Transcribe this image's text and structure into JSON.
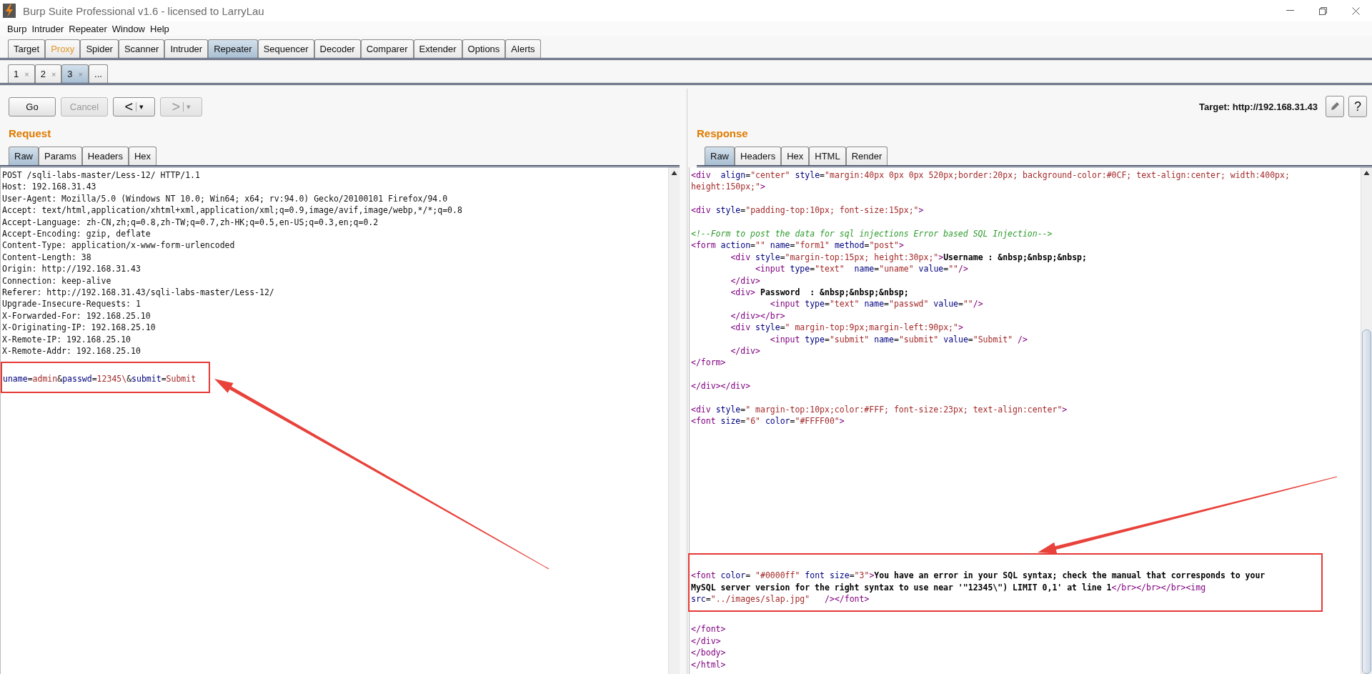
{
  "window": {
    "title": "Burp Suite Professional v1.6 - licensed to LarryLau"
  },
  "menu": [
    "Burp",
    "Intruder",
    "Repeater",
    "Window",
    "Help"
  ],
  "main_tabs": [
    {
      "label": "Target",
      "selected": false,
      "highlighted": false
    },
    {
      "label": "Proxy",
      "selected": false,
      "highlighted": true
    },
    {
      "label": "Spider",
      "selected": false,
      "highlighted": false
    },
    {
      "label": "Scanner",
      "selected": false,
      "highlighted": false
    },
    {
      "label": "Intruder",
      "selected": false,
      "highlighted": false
    },
    {
      "label": "Repeater",
      "selected": true,
      "highlighted": false
    },
    {
      "label": "Sequencer",
      "selected": false,
      "highlighted": false
    },
    {
      "label": "Decoder",
      "selected": false,
      "highlighted": false
    },
    {
      "label": "Comparer",
      "selected": false,
      "highlighted": false
    },
    {
      "label": "Extender",
      "selected": false,
      "highlighted": false
    },
    {
      "label": "Options",
      "selected": false,
      "highlighted": false
    },
    {
      "label": "Alerts",
      "selected": false,
      "highlighted": false
    }
  ],
  "sub_tabs": [
    {
      "label": "1",
      "close": "×",
      "selected": false
    },
    {
      "label": "2",
      "close": "×",
      "selected": false
    },
    {
      "label": "3",
      "close": "×",
      "selected": true
    }
  ],
  "more_tab": "...",
  "toolbar": {
    "buttons": [
      {
        "kind": "text",
        "label": "Go",
        "disabled": false
      },
      {
        "kind": "text",
        "label": "Cancel",
        "disabled": true
      },
      {
        "kind": "nav",
        "label": "<",
        "menu": "▾",
        "disabled": false
      },
      {
        "kind": "nav",
        "label": ">",
        "menu": "▾",
        "disabled": true
      }
    ],
    "target": "Target: http://192.168.31.43",
    "help": "?"
  },
  "request": {
    "title": "Request",
    "tabs": [
      {
        "label": "Raw",
        "selected": true
      },
      {
        "label": "Params",
        "selected": false
      },
      {
        "label": "Headers",
        "selected": false
      },
      {
        "label": "Hex",
        "selected": false
      }
    ],
    "headers": [
      "POST /sqli-labs-master/Less-12/ HTTP/1.1",
      "Host: 192.168.31.43",
      "User-Agent: Mozilla/5.0 (Windows NT 10.0; Win64; x64; rv:94.0) Gecko/20100101 Firefox/94.0",
      "Accept: text/html,application/xhtml+xml,application/xml;q=0.9,image/avif,image/webp,*/*;q=0.8",
      "Accept-Language: zh-CN,zh;q=0.8,zh-TW;q=0.7,zh-HK;q=0.5,en-US;q=0.3,en;q=0.2",
      "Accept-Encoding: gzip, deflate",
      "Content-Type: application/x-www-form-urlencoded",
      "Content-Length: 38",
      "Origin: http://192.168.31.43",
      "Connection: keep-alive",
      "Referer: http://192.168.31.43/sqli-labs-master/Less-12/",
      "Upgrade-Insecure-Requests: 1",
      "X-Forwarded-For: 192.168.25.10",
      "X-Originating-IP: 192.168.25.10",
      "X-Remote-IP: 192.168.25.10",
      "X-Remote-Addr: 192.168.25.10"
    ],
    "body": {
      "text": "uname=admin&passwd=12345\\&submit=Submit",
      "highlighted": true
    }
  },
  "response": {
    "title": "Response",
    "tabs": [
      {
        "label": "Raw",
        "selected": true
      },
      {
        "label": "Headers",
        "selected": false
      },
      {
        "label": "Hex",
        "selected": false
      },
      {
        "label": "HTML",
        "selected": false
      },
      {
        "label": "Render",
        "selected": false
      }
    ],
    "blocks_before": [
      [
        "<div  align=\"center\" style=\"margin:40px 0px 0px 520px;border:20px; background-color:#0CF; text-align:center; width:400px; height:150px;\">"
      ],
      [
        "<div style=\"padding-top:10px; font-size:15px;\">"
      ],
      [
        "<!--Form to post the data for sql injections Error based SQL Injection-->",
        "<form action=\"\" name=\"form1\" method=\"post\">",
        "        <div style=\"margin-top:15px; height:30px;\">Username : &nbsp;&nbsp;&nbsp;",
        "             <input type=\"text\"  name=\"uname\" value=\"\"/>",
        "        </div>",
        "        <div> Password  : &nbsp;&nbsp;&nbsp;",
        "                <input type=\"text\" name=\"passwd\" value=\"\"/>",
        "        </div></br>",
        "        <div style=\" margin-top:9px;margin-left:90px;\">",
        "                <input type=\"submit\" name=\"submit\" value=\"Submit\" />",
        "        </div>",
        "</form>"
      ],
      [
        "</div></div>"
      ],
      [
        "<div style=\" margin-top:10px;color:#FFF; font-size:23px; text-align:center\">",
        "<font size=\"6\" color=\"#FFFF00\">"
      ]
    ],
    "error": {
      "text": "<font color= \"#0000ff\" font size=\"3\">You have an error in your SQL syntax; check the manual that corresponds to your MySQL server version for the right syntax to use near '\"12345\\\") LIMIT 0,1' at line 1</br></br></br><img src=\"../images/slap.jpg\"   /></font>",
      "highlighted": true
    },
    "blocks_after": [
      [
        "</font>",
        "</div>",
        "</body>",
        "</html>"
      ]
    ]
  }
}
